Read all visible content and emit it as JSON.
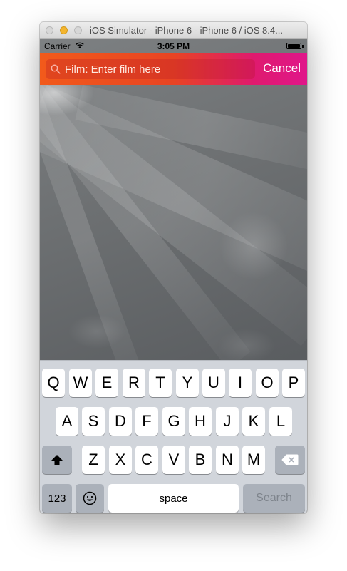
{
  "window": {
    "title": "iOS Simulator - iPhone 6 - iPhone 6 / iOS 8.4..."
  },
  "status_bar": {
    "carrier": "Carrier",
    "time": "3:05 PM"
  },
  "search": {
    "placeholder": "Film: Enter film here",
    "value": "",
    "cancel_label": "Cancel"
  },
  "keyboard": {
    "row1": [
      "Q",
      "W",
      "E",
      "R",
      "T",
      "Y",
      "U",
      "I",
      "O",
      "P"
    ],
    "row2": [
      "A",
      "S",
      "D",
      "F",
      "G",
      "H",
      "J",
      "K",
      "L"
    ],
    "row3": [
      "Z",
      "X",
      "C",
      "V",
      "B",
      "N",
      "M"
    ],
    "numbers_label": "123",
    "space_label": "space",
    "search_label": "Search",
    "shift_icon": "shift-icon",
    "delete_icon": "delete-icon",
    "emoji_icon": "emoji-icon"
  },
  "colors": {
    "bar_start": "#f25a1b",
    "bar_end": "#e0168a",
    "keyboard_bg": "#d1d5db",
    "special_key": "#abb1ba"
  }
}
